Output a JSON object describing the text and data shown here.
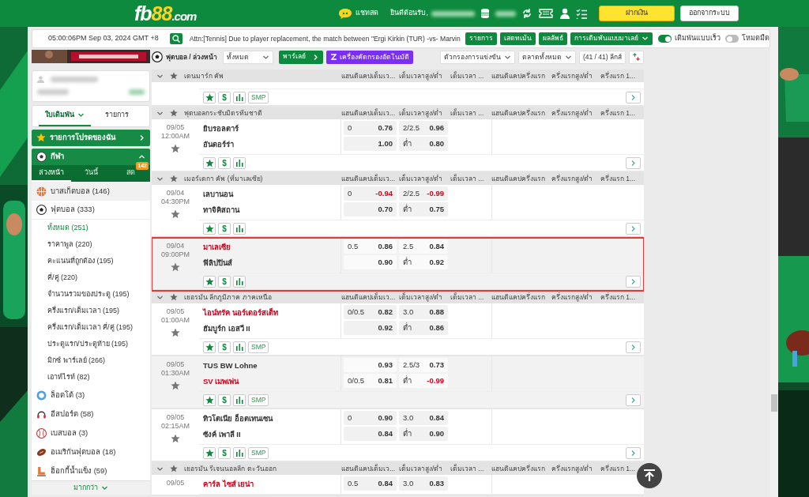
{
  "header": {
    "logo": [
      {
        "text": "fb",
        "accent": false
      },
      {
        "text": "88",
        "accent": true
      },
      {
        "text": ".com",
        "accent": false
      }
    ],
    "chat": "แชทสด",
    "welcome": "ยินดีต้อนรับ,",
    "deposit": "ฝากเงิน",
    "logout": "ออกจากระบบ"
  },
  "topbar": {
    "clock": "05:00:06PM Sep 03, 2024 GMT +8",
    "notice": "Attn:[Tennis] Due to player replacement, the match between \"Ergi Kirkin (TUR) -vs- Marvin",
    "buttons": [
      {
        "label": "รายการ",
        "dropdown": false
      },
      {
        "label": "เสตทเม้น",
        "dropdown": false
      },
      {
        "label": "ผลลัพธ์",
        "dropdown": false
      },
      {
        "label": "การเดิมพันแบบมาเลย์",
        "dropdown": true
      }
    ],
    "toggles": [
      {
        "label": "เดิมพันแบบเร็ว",
        "on": true
      },
      {
        "label": "โหมดมืด",
        "on": false
      }
    ]
  },
  "sidebar": {
    "tabs": [
      {
        "label": "ใบเดิมพัน",
        "selected": true,
        "dropdown": true
      },
      {
        "label": "รายการ",
        "selected": false,
        "dropdown": false
      }
    ],
    "favorites": "รายการโปรดของฉัน",
    "sports_title": "กีฬา",
    "sport_tabs": [
      {
        "label": "ล่วงหน้า",
        "selected": true
      },
      {
        "label": "วันนี้",
        "selected": false
      },
      {
        "label": "สด",
        "selected": false,
        "badge": "142"
      }
    ],
    "sports": [
      {
        "kind": "basketball",
        "label": "บาสเก็ตบอล (146)"
      },
      {
        "kind": "football",
        "label": "ฟุตบอล (333)",
        "children": [
          {
            "label": "ทั้งหมด (251)",
            "selected": true
          },
          {
            "label": "ราคาพูล (220)",
            "selected": false
          },
          {
            "label": "คะแนนที่ถูกต้อง (195)",
            "selected": false
          },
          {
            "label": "คี่/คู่ (220)",
            "selected": false
          },
          {
            "label": "จำนวนรวมของประตู (195)",
            "selected": false
          },
          {
            "label": "ครึ่งแรก/เต็มเวลา (195)",
            "selected": false
          },
          {
            "label": "ครึ่งแรก/เต็มเวลา คี่/คู่ (195)",
            "selected": false
          },
          {
            "label": "ประตูแรก/ประตูท้าย (195)",
            "selected": false
          },
          {
            "label": "มิกซ์ พาร์เลย์ (266)",
            "selected": false
          },
          {
            "label": "เอาท์ไรท์ (82)",
            "selected": false
          }
        ]
      },
      {
        "kind": "lotto",
        "label": "ล็อตโต้ (3)"
      },
      {
        "kind": "esports",
        "label": "อีสปอร์ต (58)"
      },
      {
        "kind": "baseball",
        "label": "เบสบอล (3)"
      },
      {
        "kind": "american-football",
        "label": "อเมริกันฟุตบอล (18)"
      },
      {
        "kind": "ice-hockey",
        "label": "ฮ็อกกี้น้ำแข็ง (59)"
      }
    ],
    "more": "มากกว่า"
  },
  "toolbar": {
    "breadcrumb": "ฟุตบอล / ล่วงหน้า",
    "league_select": "ทั้งหมด",
    "parlay": "พาร์เลย์",
    "auto_filter": "เครื่องคัดกรองอัตโนมัติ",
    "match_filter": "ตัวกรองการแข่งขัน",
    "market_filter": "ตลาดทั้งหมด",
    "league_count": "(41 / 41) ลีกส์"
  },
  "leagues": [
    {
      "name": "เดนมาร์ก คัพ",
      "columns": [
        "แฮนดิแคปเต็มเว...",
        "เต็มเวลาสูง/ต่ำ",
        "เต็มเวลา ...",
        "แฮนดิแคปครึ่งแรก",
        "ครึ่งแรกสูง/ต่ำ",
        "ครึ่งแรก 1..."
      ],
      "matches": [
        {
          "shaded": false,
          "highlighted": false,
          "bet": "$",
          "smp": "SMP"
        }
      ]
    },
    {
      "name": "ฟุตบอลกระชับมิตรทีมชาติ",
      "columns": [
        "แฮนดิแคปเต็มเว...",
        "เต็มเวลาสูง/ต่ำ",
        "เต็มเวลา ...",
        "แฮนดิแคปครึ่งแรก",
        "ครึ่งแรกสูง/ต่ำ",
        "ครึ่งแรก 1..."
      ],
      "matches": [
        {
          "date": "09/05",
          "time": "12:00AM",
          "home": {
            "name": "ยิบรอลตาร์",
            "red": false
          },
          "away": {
            "name": "อันดอร์ร่า",
            "red": false
          },
          "hdp": [
            {
              "line": "0",
              "price": "0.76",
              "red": false
            },
            {
              "price": "1.00",
              "red": false
            }
          ],
          "ou": [
            {
              "line": "2/2.5",
              "price": "0.96",
              "red": false
            },
            {
              "line": "ต่ำ",
              "price": "0.80",
              "red": false
            }
          ],
          "shaded": false,
          "highlighted": false,
          "bet": "$"
        }
      ]
    },
    {
      "name": "เมอร์เดกา คัพ (ที่มาเลเซีย)",
      "columns": [
        "แฮนดิแคปเต็มเว...",
        "เต็มเวลาสูง/ต่ำ",
        "เต็มเวลา ...",
        "แฮนดิแคปครึ่งแรก",
        "ครึ่งแรกสูง/ต่ำ",
        "ครึ่งแรก 1..."
      ],
      "matches": [
        {
          "date": "09/04",
          "time": "04:30PM",
          "home": {
            "name": "เลบานอน",
            "red": false
          },
          "away": {
            "name": "ทาจิคิสถาน",
            "red": false
          },
          "hdp": [
            {
              "line": "0",
              "price": "-0.94",
              "red": true
            },
            {
              "price": "0.70",
              "red": false
            }
          ],
          "ou": [
            {
              "line": "2/2.5",
              "price": "-0.99",
              "red": true
            },
            {
              "line": "ต่ำ",
              "price": "0.75",
              "red": false
            }
          ],
          "shaded": false,
          "highlighted": false,
          "bet": "$"
        },
        {
          "date": "09/04",
          "time": "09:00PM",
          "home": {
            "name": "มาเลเซีย",
            "red": true
          },
          "away": {
            "name": "ฟิลิปปินส์",
            "red": false
          },
          "hdp": [
            {
              "line": "0.5",
              "price": "0.86",
              "red": false
            },
            {
              "price": "0.90",
              "red": false
            }
          ],
          "ou": [
            {
              "line": "2.5",
              "price": "0.84",
              "red": false
            },
            {
              "line": "ต่ำ",
              "price": "0.92",
              "red": false
            }
          ],
          "shaded": true,
          "highlighted": true,
          "bet": "$"
        }
      ]
    },
    {
      "name": "เยอรมัน ลีกภูมิภาค ภาคเหนือ",
      "columns": [
        "แฮนดิแคปเต็มเว...",
        "เต็มเวลาสูง/ต่ำ",
        "เต็มเวลา ...",
        "แฮนดิแคปครึ่งแรก",
        "ครึ่งแรกสูง/ต่ำ",
        "ครึ่งแรก 1..."
      ],
      "matches": [
        {
          "date": "09/05",
          "time": "01:00AM",
          "home": {
            "name": "ไอน์ทรัค นอร์เดอร์สเต็ท",
            "red": true
          },
          "away": {
            "name": "ฮัมบูร์ก เอสวี II",
            "red": false
          },
          "hdp": [
            {
              "line": "0/0.5",
              "price": "0.82",
              "red": false
            },
            {
              "price": "0.92",
              "red": false
            }
          ],
          "ou": [
            {
              "line": "3.0",
              "price": "0.88",
              "red": false
            },
            {
              "line": "ต่ำ",
              "price": "0.86",
              "red": false
            }
          ],
          "shaded": false,
          "highlighted": false,
          "bet": "$",
          "smp": "SMP"
        },
        {
          "date": "09/05",
          "time": "01:30AM",
          "home": {
            "name": "TUS BW Lohne",
            "red": false
          },
          "away": {
            "name": "SV เมพเพ่น",
            "red": true
          },
          "hdp": [
            {
              "price": "0.93",
              "red": false
            },
            {
              "line": "0/0.5",
              "price": "0.81",
              "red": false
            }
          ],
          "ou": [
            {
              "line": "2.5/3",
              "price": "0.73",
              "red": false
            },
            {
              "line": "ต่ำ",
              "price": "-0.99",
              "red": true
            }
          ],
          "shaded": true,
          "highlighted": false,
          "bet": "$",
          "smp": "SMP"
        },
        {
          "date": "09/05",
          "time": "02:15AM",
          "home": {
            "name": "ทิวโตเนีย อ็อตเทนเซน",
            "red": false
          },
          "away": {
            "name": "ซังค์ เพาลี II",
            "red": false
          },
          "hdp": [
            {
              "line": "0",
              "price": "0.90",
              "red": false
            },
            {
              "price": "0.84",
              "red": false
            }
          ],
          "ou": [
            {
              "line": "3.0",
              "price": "0.84",
              "red": false
            },
            {
              "line": "ต่ำ",
              "price": "0.90",
              "red": false
            }
          ],
          "shaded": false,
          "highlighted": false,
          "bet": "$",
          "smp": "SMP"
        }
      ]
    },
    {
      "name": "เยอรมัน รีเจนนอลลีก ตะวันออก",
      "columns": [
        "แฮนดิแคปเต็มเว...",
        "เต็มเวลาสูง/ต่ำ",
        "เต็มเวลา ...",
        "แฮนดิแคปครึ่งแรก",
        "ครึ่งแรกสูง/ต่ำ",
        "ครึ่งแรก 1..."
      ],
      "matches": [
        {
          "date": "09/05",
          "home": {
            "name": "คาร์ล ไซส์ เยน่า",
            "red": true
          },
          "hdp": [
            {
              "line": "0.5",
              "price": "0.84",
              "red": false
            }
          ],
          "ou": [
            {
              "line": "3.0",
              "price": "0.83",
              "red": false
            }
          ],
          "shaded": false,
          "highlighted": false
        }
      ]
    }
  ]
}
